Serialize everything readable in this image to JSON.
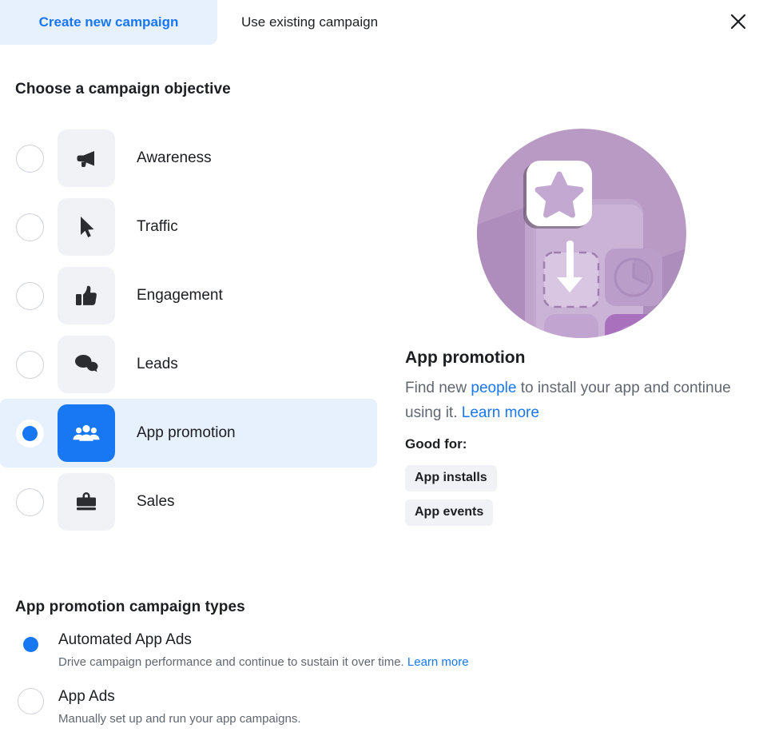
{
  "tabs": [
    {
      "label": "Create new campaign",
      "active": true,
      "name": "tab-create-new-campaign"
    },
    {
      "label": "Use existing campaign",
      "active": false,
      "name": "tab-use-existing-campaign"
    }
  ],
  "close_icon": "close-icon",
  "objective_section": {
    "title": "Choose a campaign objective",
    "options": [
      {
        "label": "Awareness",
        "icon": "megaphone-icon",
        "selected": false
      },
      {
        "label": "Traffic",
        "icon": "cursor-icon",
        "selected": false
      },
      {
        "label": "Engagement",
        "icon": "thumbs-up-icon",
        "selected": false
      },
      {
        "label": "Leads",
        "icon": "chat-bubbles-icon",
        "selected": false
      },
      {
        "label": "App promotion",
        "icon": "people-group-icon",
        "selected": true
      },
      {
        "label": "Sales",
        "icon": "shopping-bag-icon",
        "selected": false
      }
    ]
  },
  "info_panel": {
    "illustration": "app-promotion-illustration",
    "title": "App promotion",
    "description_part1": "Find new ",
    "description_link1": "people",
    "description_part2": " to install your app and continue using it. ",
    "description_link2": "Learn more",
    "good_for_label": "Good for:",
    "badges": [
      "App installs",
      "App events"
    ]
  },
  "campaign_types_section": {
    "title": "App promotion campaign types",
    "options": [
      {
        "label": "Automated App Ads",
        "description": "Drive campaign performance and continue to sustain it over time. ",
        "link": "Learn more",
        "selected": true
      },
      {
        "label": "App Ads",
        "description": "Manually set up and run your app campaigns.",
        "link": "",
        "selected": false
      }
    ]
  },
  "colors": {
    "accent_blue": "#1877f2",
    "highlight_blue": "#e7f0fd",
    "tile_gray": "#f0f2f5",
    "text_primary": "#1c1e21",
    "text_secondary": "#606770",
    "illustration_purple": "#b89ac4"
  }
}
